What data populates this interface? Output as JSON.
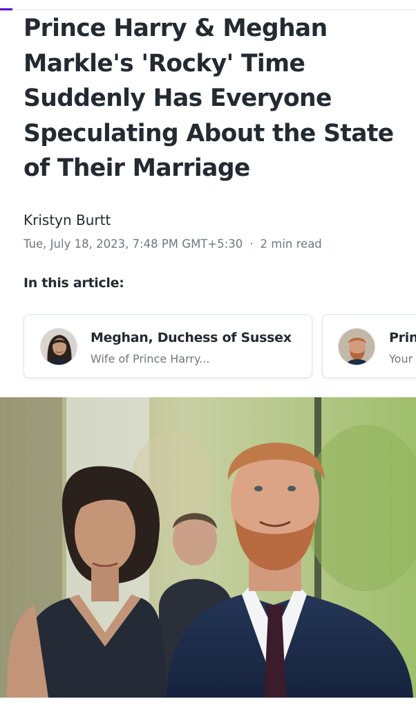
{
  "article": {
    "headline": "Prince Harry & Meghan Markle's 'Rocky' Time Suddenly Has Everyone Speculating About the State of Their Marriage",
    "author": "Kristyn Burtt",
    "timestamp": "Tue, July 18, 2023, 7:48 PM GMT+5:30",
    "separator": "·",
    "read_time": "2 min read"
  },
  "in_this_article": {
    "label": "In this article:",
    "cards": [
      {
        "name": "Meghan, Duchess of Sussex",
        "description": "Wife of Prince Harry...",
        "icon": "avatar-meghan"
      },
      {
        "name": "Prin",
        "description": "Your",
        "icon": "avatar-harry"
      }
    ]
  },
  "hero_image": {
    "subject": "photo-meghan-and-harry"
  },
  "colors": {
    "accent": "#6001d2",
    "text_primary": "#232a31",
    "text_secondary": "#6e7780",
    "border": "#e0e4e9"
  }
}
